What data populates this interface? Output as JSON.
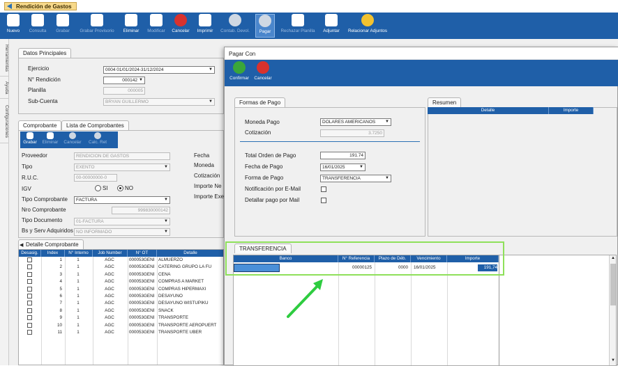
{
  "app": {
    "title": "Rendición de Gastos"
  },
  "toolbar": {
    "items": [
      {
        "label": "Nuevo",
        "state": "enabled"
      },
      {
        "label": "Consulta",
        "state": "disabled"
      },
      {
        "label": "Grabar",
        "state": "disabled"
      },
      {
        "label": "Grabar Provisorio",
        "state": "disabled"
      },
      {
        "label": "Eliminar",
        "state": "enabled"
      },
      {
        "label": "Modificar",
        "state": "disabled"
      },
      {
        "label": "Cancelar",
        "state": "enabled"
      },
      {
        "label": "Imprimir",
        "state": "enabled"
      },
      {
        "label": "Contab. Devol.",
        "state": "disabled"
      },
      {
        "label": "Pagar",
        "state": "selected"
      },
      {
        "label": "Rechazar Planilla",
        "state": "disabled"
      },
      {
        "label": "Adjuntar",
        "state": "enabled"
      },
      {
        "label": "Relacionar Adjuntos",
        "state": "enabled"
      }
    ]
  },
  "side_tabs": [
    "Herramientas",
    "Ayuda",
    "Configuraciones"
  ],
  "datos_principales": {
    "tab": "Datos Principales",
    "ejercicio_label": "Ejercicio",
    "ejercicio_value": "0004 01/01/2024-31/12/2024",
    "nro_rendicion_label": "N° Rendición",
    "nro_rendicion_value": "000142",
    "planilla_label": "Planilla",
    "planilla_value": "000005",
    "subcuenta_label": "Sub-Cuenta",
    "subcuenta_value": "BRYAN GUILLERMO"
  },
  "comprobante": {
    "tabs": [
      "Comprobante",
      "Lista de Comprobantes"
    ],
    "mini_toolbar": [
      "Grabar",
      "Eliminar",
      "Cancelar",
      "Calc. Ret"
    ],
    "proveedor_label": "Proveedor",
    "proveedor_value": "RENDICION DE GASTOS",
    "tipo_label": "Tipo",
    "tipo_value": "EXENTO",
    "ruc_label": "R.U.C.",
    "ruc_value": "00-00000000-0",
    "igv_label": "IGV",
    "igv_si": "SI",
    "igv_no": "NO",
    "tipo_comprobante_label": "Tipo Comprobante",
    "tipo_comprobante_value": "FACTURA",
    "nro_comprobante_label": "Nro Comprobante",
    "nro_comprobante_value": "999830000142",
    "tipo_documento_label": "Tipo Documento",
    "tipo_documento_value": "01-FACTURA",
    "bs_label": "Bs y Serv Adquiridos",
    "bs_value": "NO INFORMADO",
    "right_labels": [
      "Fecha",
      "Moneda",
      "Cotización",
      "Importe Ne",
      "Importe Exe"
    ]
  },
  "detalle": {
    "tab": "Detalle Comprobante",
    "columns": [
      "Desasig.",
      "Index",
      "N° Interno",
      "Job Number",
      "N° OT",
      "Detalle"
    ],
    "rows": [
      [
        "1",
        "1",
        "AGC",
        "000053GENE",
        "ALMUERZO"
      ],
      [
        "2",
        "1",
        "AGC",
        "000053GENE",
        "CATERING GRUPO LA FU"
      ],
      [
        "3",
        "1",
        "AGC",
        "000053GENE",
        "CENA"
      ],
      [
        "4",
        "1",
        "AGC",
        "000053GENE",
        "COMPRAS A MARKET"
      ],
      [
        "5",
        "1",
        "AGC",
        "000053GENE",
        "COMPRAS HIPERMAXI"
      ],
      [
        "6",
        "1",
        "AGC",
        "000053GENE",
        "DESAYUNO"
      ],
      [
        "7",
        "1",
        "AGC",
        "000053GENE",
        "DESAYUNO WISTUPIKU"
      ],
      [
        "8",
        "1",
        "AGC",
        "000053GENE",
        "SNACK"
      ],
      [
        "9",
        "1",
        "AGC",
        "000053GENE",
        "TRANSPORTE"
      ],
      [
        "10",
        "1",
        "AGC",
        "000053GENE",
        "TRANSPORTE AEROPUERT"
      ],
      [
        "11",
        "1",
        "AGC",
        "000053GENE",
        "TRANSPORTE UBER"
      ]
    ]
  },
  "modal": {
    "title": "Pagar Con",
    "confirm_label": "Confirmar",
    "cancel_label": "Cancelar",
    "formas_tab": "Formas de Pago",
    "moneda_label": "Moneda Pago",
    "moneda_value": "DOLARES AMERICANOS",
    "cotizacion_label": "Cotización",
    "cotizacion_value": "3.7250",
    "total_label": "Total Orden de Pago",
    "total_value": "191.74",
    "fecha_label": "Fecha de Pago",
    "fecha_value": "16/01/2025",
    "forma_label": "Forma de Pago",
    "forma_value": "TRANSFERENCIA",
    "notif_label": "Notificación por E-Mail",
    "detallar_label": "Detallar pago por Mail",
    "resumen_tab": "Resumen",
    "resumen_cols": [
      "Detalle",
      "Importe"
    ],
    "transfer_tab": "TRANSFERENCIA",
    "transfer_cols": [
      "Banco",
      "N° Referencia",
      "Plazo de Déb.",
      "Vencimiento",
      "Importe"
    ],
    "transfer_row": [
      "",
      "00000125",
      "0000",
      "16/01/2025",
      "191,74"
    ]
  },
  "colors": {
    "toolbar": "#1f5fa8",
    "highlight_box": "#8ee05a",
    "arrow": "#2ecc40"
  }
}
